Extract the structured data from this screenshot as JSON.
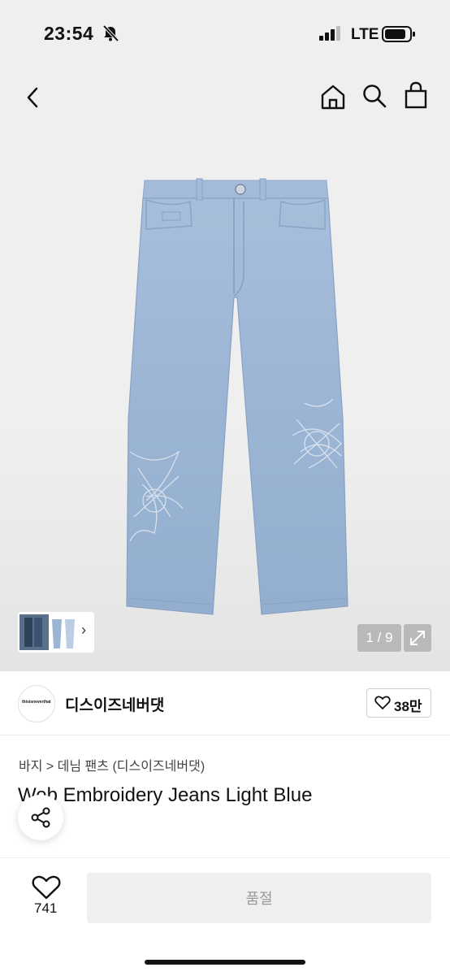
{
  "status_bar": {
    "time": "23:54",
    "network": "LTE"
  },
  "nav": {
    "back_icon": "chevron-left-icon",
    "home_icon": "home-icon",
    "search_icon": "search-icon",
    "bag_icon": "shopping-bag-icon"
  },
  "gallery": {
    "counter": "1 / 9",
    "thumb_arrow": "›"
  },
  "store": {
    "logo_text": "thisisneverthat",
    "name": "디스이즈네버댓",
    "likes": "38만"
  },
  "product": {
    "breadcrumb": "바지 > 데님 팬츠 (디스이즈네버댓)",
    "title": "Web Embroidery Jeans Light Blue"
  },
  "bottom": {
    "wish_count": "741",
    "buy_label": "품절"
  }
}
